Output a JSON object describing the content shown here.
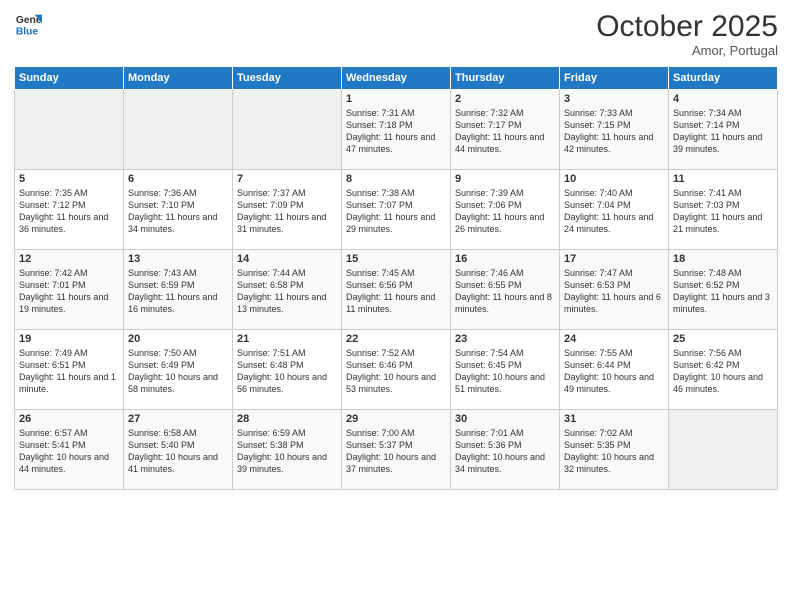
{
  "header": {
    "logo_general": "General",
    "logo_blue": "Blue",
    "month": "October 2025",
    "location": "Amor, Portugal"
  },
  "days_of_week": [
    "Sunday",
    "Monday",
    "Tuesday",
    "Wednesday",
    "Thursday",
    "Friday",
    "Saturday"
  ],
  "weeks": [
    [
      {
        "day": "",
        "info": ""
      },
      {
        "day": "",
        "info": ""
      },
      {
        "day": "",
        "info": ""
      },
      {
        "day": "1",
        "info": "Sunrise: 7:31 AM\nSunset: 7:18 PM\nDaylight: 11 hours and 47 minutes."
      },
      {
        "day": "2",
        "info": "Sunrise: 7:32 AM\nSunset: 7:17 PM\nDaylight: 11 hours and 44 minutes."
      },
      {
        "day": "3",
        "info": "Sunrise: 7:33 AM\nSunset: 7:15 PM\nDaylight: 11 hours and 42 minutes."
      },
      {
        "day": "4",
        "info": "Sunrise: 7:34 AM\nSunset: 7:14 PM\nDaylight: 11 hours and 39 minutes."
      }
    ],
    [
      {
        "day": "5",
        "info": "Sunrise: 7:35 AM\nSunset: 7:12 PM\nDaylight: 11 hours and 36 minutes."
      },
      {
        "day": "6",
        "info": "Sunrise: 7:36 AM\nSunset: 7:10 PM\nDaylight: 11 hours and 34 minutes."
      },
      {
        "day": "7",
        "info": "Sunrise: 7:37 AM\nSunset: 7:09 PM\nDaylight: 11 hours and 31 minutes."
      },
      {
        "day": "8",
        "info": "Sunrise: 7:38 AM\nSunset: 7:07 PM\nDaylight: 11 hours and 29 minutes."
      },
      {
        "day": "9",
        "info": "Sunrise: 7:39 AM\nSunset: 7:06 PM\nDaylight: 11 hours and 26 minutes."
      },
      {
        "day": "10",
        "info": "Sunrise: 7:40 AM\nSunset: 7:04 PM\nDaylight: 11 hours and 24 minutes."
      },
      {
        "day": "11",
        "info": "Sunrise: 7:41 AM\nSunset: 7:03 PM\nDaylight: 11 hours and 21 minutes."
      }
    ],
    [
      {
        "day": "12",
        "info": "Sunrise: 7:42 AM\nSunset: 7:01 PM\nDaylight: 11 hours and 19 minutes."
      },
      {
        "day": "13",
        "info": "Sunrise: 7:43 AM\nSunset: 6:59 PM\nDaylight: 11 hours and 16 minutes."
      },
      {
        "day": "14",
        "info": "Sunrise: 7:44 AM\nSunset: 6:58 PM\nDaylight: 11 hours and 13 minutes."
      },
      {
        "day": "15",
        "info": "Sunrise: 7:45 AM\nSunset: 6:56 PM\nDaylight: 11 hours and 11 minutes."
      },
      {
        "day": "16",
        "info": "Sunrise: 7:46 AM\nSunset: 6:55 PM\nDaylight: 11 hours and 8 minutes."
      },
      {
        "day": "17",
        "info": "Sunrise: 7:47 AM\nSunset: 6:53 PM\nDaylight: 11 hours and 6 minutes."
      },
      {
        "day": "18",
        "info": "Sunrise: 7:48 AM\nSunset: 6:52 PM\nDaylight: 11 hours and 3 minutes."
      }
    ],
    [
      {
        "day": "19",
        "info": "Sunrise: 7:49 AM\nSunset: 6:51 PM\nDaylight: 11 hours and 1 minute."
      },
      {
        "day": "20",
        "info": "Sunrise: 7:50 AM\nSunset: 6:49 PM\nDaylight: 10 hours and 58 minutes."
      },
      {
        "day": "21",
        "info": "Sunrise: 7:51 AM\nSunset: 6:48 PM\nDaylight: 10 hours and 56 minutes."
      },
      {
        "day": "22",
        "info": "Sunrise: 7:52 AM\nSunset: 6:46 PM\nDaylight: 10 hours and 53 minutes."
      },
      {
        "day": "23",
        "info": "Sunrise: 7:54 AM\nSunset: 6:45 PM\nDaylight: 10 hours and 51 minutes."
      },
      {
        "day": "24",
        "info": "Sunrise: 7:55 AM\nSunset: 6:44 PM\nDaylight: 10 hours and 49 minutes."
      },
      {
        "day": "25",
        "info": "Sunrise: 7:56 AM\nSunset: 6:42 PM\nDaylight: 10 hours and 46 minutes."
      }
    ],
    [
      {
        "day": "26",
        "info": "Sunrise: 6:57 AM\nSunset: 5:41 PM\nDaylight: 10 hours and 44 minutes."
      },
      {
        "day": "27",
        "info": "Sunrise: 6:58 AM\nSunset: 5:40 PM\nDaylight: 10 hours and 41 minutes."
      },
      {
        "day": "28",
        "info": "Sunrise: 6:59 AM\nSunset: 5:38 PM\nDaylight: 10 hours and 39 minutes."
      },
      {
        "day": "29",
        "info": "Sunrise: 7:00 AM\nSunset: 5:37 PM\nDaylight: 10 hours and 37 minutes."
      },
      {
        "day": "30",
        "info": "Sunrise: 7:01 AM\nSunset: 5:36 PM\nDaylight: 10 hours and 34 minutes."
      },
      {
        "day": "31",
        "info": "Sunrise: 7:02 AM\nSunset: 5:35 PM\nDaylight: 10 hours and 32 minutes."
      },
      {
        "day": "",
        "info": ""
      }
    ]
  ]
}
